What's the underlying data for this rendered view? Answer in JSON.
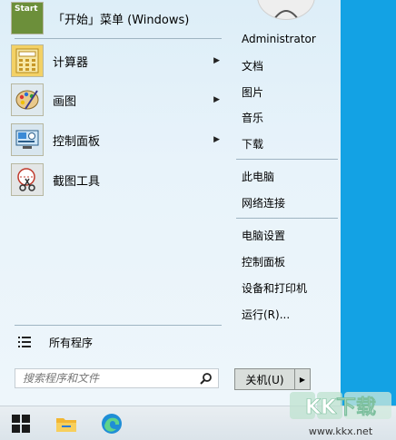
{
  "start_menu": {
    "pinned": {
      "label": "「开始」菜单 (Windows)",
      "icon_text": "Start"
    },
    "apps": [
      {
        "label": "计算器",
        "icon": "calculator-icon",
        "has_submenu": true
      },
      {
        "label": "画图",
        "icon": "paint-icon",
        "has_submenu": true
      },
      {
        "label": "控制面板",
        "icon": "control-panel-icon",
        "has_submenu": true
      },
      {
        "label": "截图工具",
        "icon": "snipping-tool-icon",
        "has_submenu": false
      }
    ],
    "all_programs": "所有程序",
    "search_placeholder": "搜索程序和文件"
  },
  "right_panel": {
    "group1": [
      "Administrator",
      "文档",
      "图片",
      "音乐",
      "下载"
    ],
    "group2": [
      "此电脑",
      "网络连接"
    ],
    "group3": [
      "电脑设置",
      "控制面板",
      "设备和打印机",
      "运行(R)..."
    ]
  },
  "shutdown": {
    "label": "关机(U)"
  },
  "watermark": {
    "logo": "KK下载",
    "url": "www.kkx.net"
  }
}
